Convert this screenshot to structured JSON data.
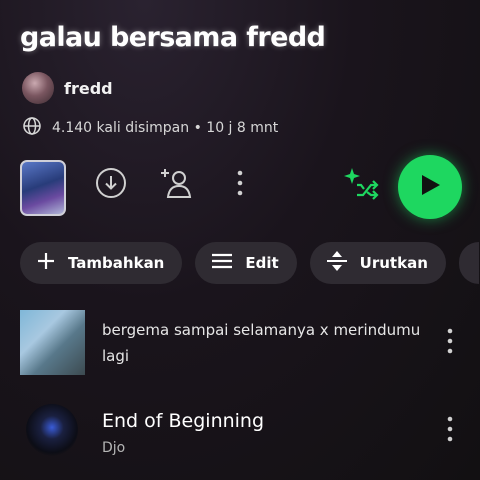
{
  "playlist": {
    "title": "galau bersama fredd",
    "owner": "fredd",
    "meta": "4.140 kali disimpan • 10 j 8 mnt"
  },
  "actions": {
    "icons": [
      "download-icon",
      "add-user-icon",
      "more-vertical-icon",
      "smart-shuffle-icon",
      "play-icon"
    ],
    "accent": "#1ed760"
  },
  "chips": [
    {
      "label": "Tambahkan",
      "icon": "plus-icon"
    },
    {
      "label": "Edit",
      "icon": "list-icon"
    },
    {
      "label": "Urutkan",
      "icon": "sort-icon"
    }
  ],
  "tracks": [
    {
      "title": "bergema sampai selamanya x merindumu lagi",
      "artist": ""
    },
    {
      "title": "End of Beginning",
      "artist": "Djo"
    }
  ]
}
